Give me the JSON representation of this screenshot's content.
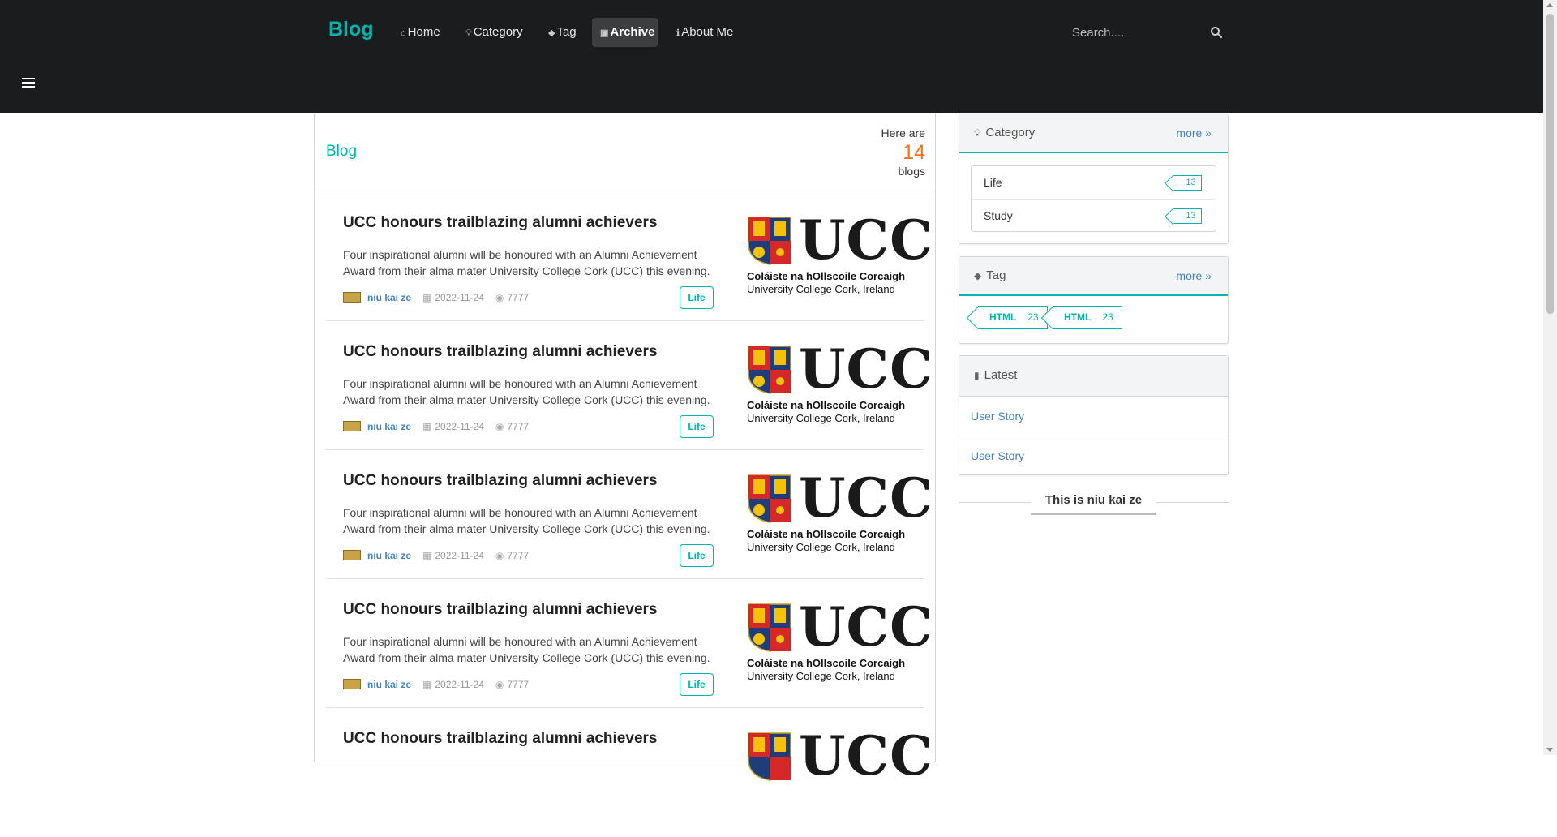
{
  "nav": {
    "brand": "Blog",
    "items": [
      {
        "label": "Home",
        "icon": "home-icon"
      },
      {
        "label": "Category",
        "icon": "lightbulb-icon"
      },
      {
        "label": "Tag",
        "icon": "tags-icon"
      },
      {
        "label": "Archive",
        "icon": "archive-icon",
        "active": true
      },
      {
        "label": "About Me",
        "icon": "info-icon"
      }
    ],
    "search_placeholder": "Search...."
  },
  "main": {
    "title": "Blog",
    "count_prefix": "Here are",
    "count": "14",
    "count_suffix": "blogs"
  },
  "posts": [
    {
      "title": "UCC honours trailblazing alumni achievers",
      "excerpt": "Four inspirational alumni will be honoured with an Alumni Achievement Award from their alma mater University College Cork (UCC) this evening.",
      "author": "niu kai ze",
      "date": "2022-11-24",
      "views": "7777",
      "category": "Life",
      "logo_irish": "Coláiste na hOllscoile Corcaigh",
      "logo_english": "University College Cork, Ireland",
      "logo_text": "UCC"
    },
    {
      "title": "UCC honours trailblazing alumni achievers",
      "excerpt": "Four inspirational alumni will be honoured with an Alumni Achievement Award from their alma mater University College Cork (UCC) this evening.",
      "author": "niu kai ze",
      "date": "2022-11-24",
      "views": "7777",
      "category": "Life",
      "logo_irish": "Coláiste na hOllscoile Corcaigh",
      "logo_english": "University College Cork, Ireland",
      "logo_text": "UCC"
    },
    {
      "title": "UCC honours trailblazing alumni achievers",
      "excerpt": "Four inspirational alumni will be honoured with an Alumni Achievement Award from their alma mater University College Cork (UCC) this evening.",
      "author": "niu kai ze",
      "date": "2022-11-24",
      "views": "7777",
      "category": "Life",
      "logo_irish": "Coláiste na hOllscoile Corcaigh",
      "logo_english": "University College Cork, Ireland",
      "logo_text": "UCC"
    },
    {
      "title": "UCC honours trailblazing alumni achievers",
      "excerpt": "Four inspirational alumni will be honoured with an Alumni Achievement Award from their alma mater University College Cork (UCC) this evening.",
      "author": "niu kai ze",
      "date": "2022-11-24",
      "views": "7777",
      "category": "Life",
      "logo_irish": "Coláiste na hOllscoile Corcaigh",
      "logo_english": "University College Cork, Ireland",
      "logo_text": "UCC"
    },
    {
      "title": "UCC honours trailblazing alumni achievers",
      "excerpt": "",
      "author": "",
      "date": "",
      "views": "",
      "category": "",
      "logo_irish": "",
      "logo_english": "",
      "logo_text": "UCC"
    }
  ],
  "sidebar": {
    "category": {
      "title": "Category",
      "more": "more",
      "items": [
        {
          "label": "Life",
          "count": "13"
        },
        {
          "label": "Study",
          "count": "13"
        }
      ]
    },
    "tag": {
      "title": "Tag",
      "more": "more",
      "items": [
        {
          "label": "HTML",
          "count": "23"
        },
        {
          "label": "HTML",
          "count": "23"
        }
      ]
    },
    "latest": {
      "title": "Latest",
      "items": [
        "User Story",
        "User Story"
      ]
    },
    "about_title": "This is niu kai ze"
  },
  "colors": {
    "accent": "#00b5ad",
    "link": "#4183c4",
    "count": "#f2711c",
    "nav_bg": "#1b1c1d"
  }
}
